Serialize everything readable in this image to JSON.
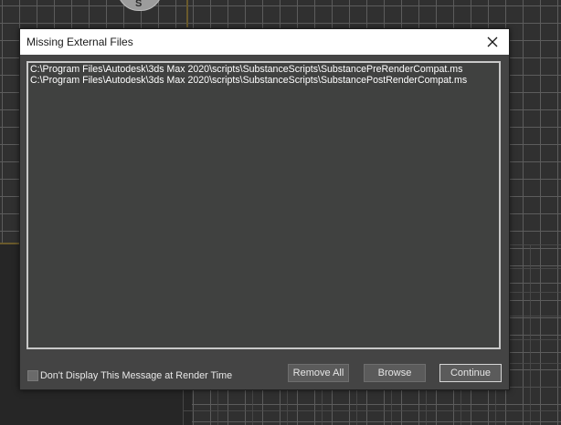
{
  "viewport": {
    "gizmo_label": "S"
  },
  "dialog": {
    "title": "Missing External Files",
    "close_icon": "close-icon",
    "files": [
      "C:\\Program Files\\Autodesk\\3ds Max 2020\\scripts\\SubstanceScripts\\SubstancePreRenderCompat.ms",
      "C:\\Program Files\\Autodesk\\3ds Max 2020\\scripts\\SubstanceScripts\\SubstancePostRenderCompat.ms"
    ],
    "checkbox_label": "Don't Display This Message at Render Time",
    "checkbox_checked": false,
    "buttons": {
      "remove_all": "Remove All",
      "browse": "Browse",
      "continue": "Continue"
    }
  }
}
